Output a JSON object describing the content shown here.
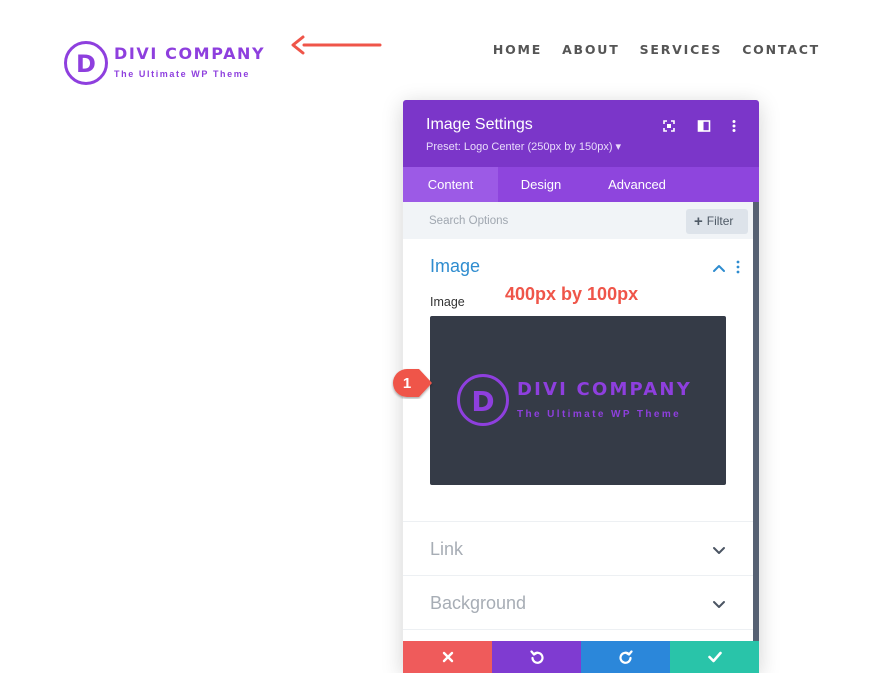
{
  "site": {
    "logo": {
      "letter": "D",
      "name": "DIVI COMPANY",
      "tagline": "The Ultimate WP Theme"
    },
    "nav": [
      "HOME",
      "ABOUT",
      "SERVICES",
      "CONTACT"
    ]
  },
  "panel": {
    "title": "Image Settings",
    "preset": "Preset: Logo Center (250px by 150px) ▾",
    "tabs": [
      {
        "label": "Content",
        "active": true
      },
      {
        "label": "Design",
        "active": false
      },
      {
        "label": "Advanced",
        "active": false
      }
    ],
    "search_placeholder": "Search Options",
    "filter_label": "Filter",
    "sections": {
      "image": {
        "title": "Image",
        "field_label": "Image"
      },
      "link": {
        "title": "Link"
      },
      "background": {
        "title": "Background"
      }
    },
    "preview": {
      "letter": "D",
      "name": "DIVI COMPANY",
      "tagline": "The Ultimate WP Theme",
      "bg": "#353b47"
    },
    "bottom_actions": [
      "cancel",
      "undo",
      "redo",
      "save"
    ]
  },
  "annotations": {
    "dims_note": "400px by 100px",
    "badge_number": "1"
  },
  "colors": {
    "brand_purple": "#8e3fde",
    "header_purple": "#7b36c9",
    "tabs_purple": "#8e45dd",
    "accent_blue": "#2e8ccf",
    "annotation_red": "#ef5549",
    "cancel_red": "#ef5b5b",
    "undo_purple": "#7f3bd1",
    "redo_blue": "#2b87da",
    "save_green": "#29c4a9"
  }
}
